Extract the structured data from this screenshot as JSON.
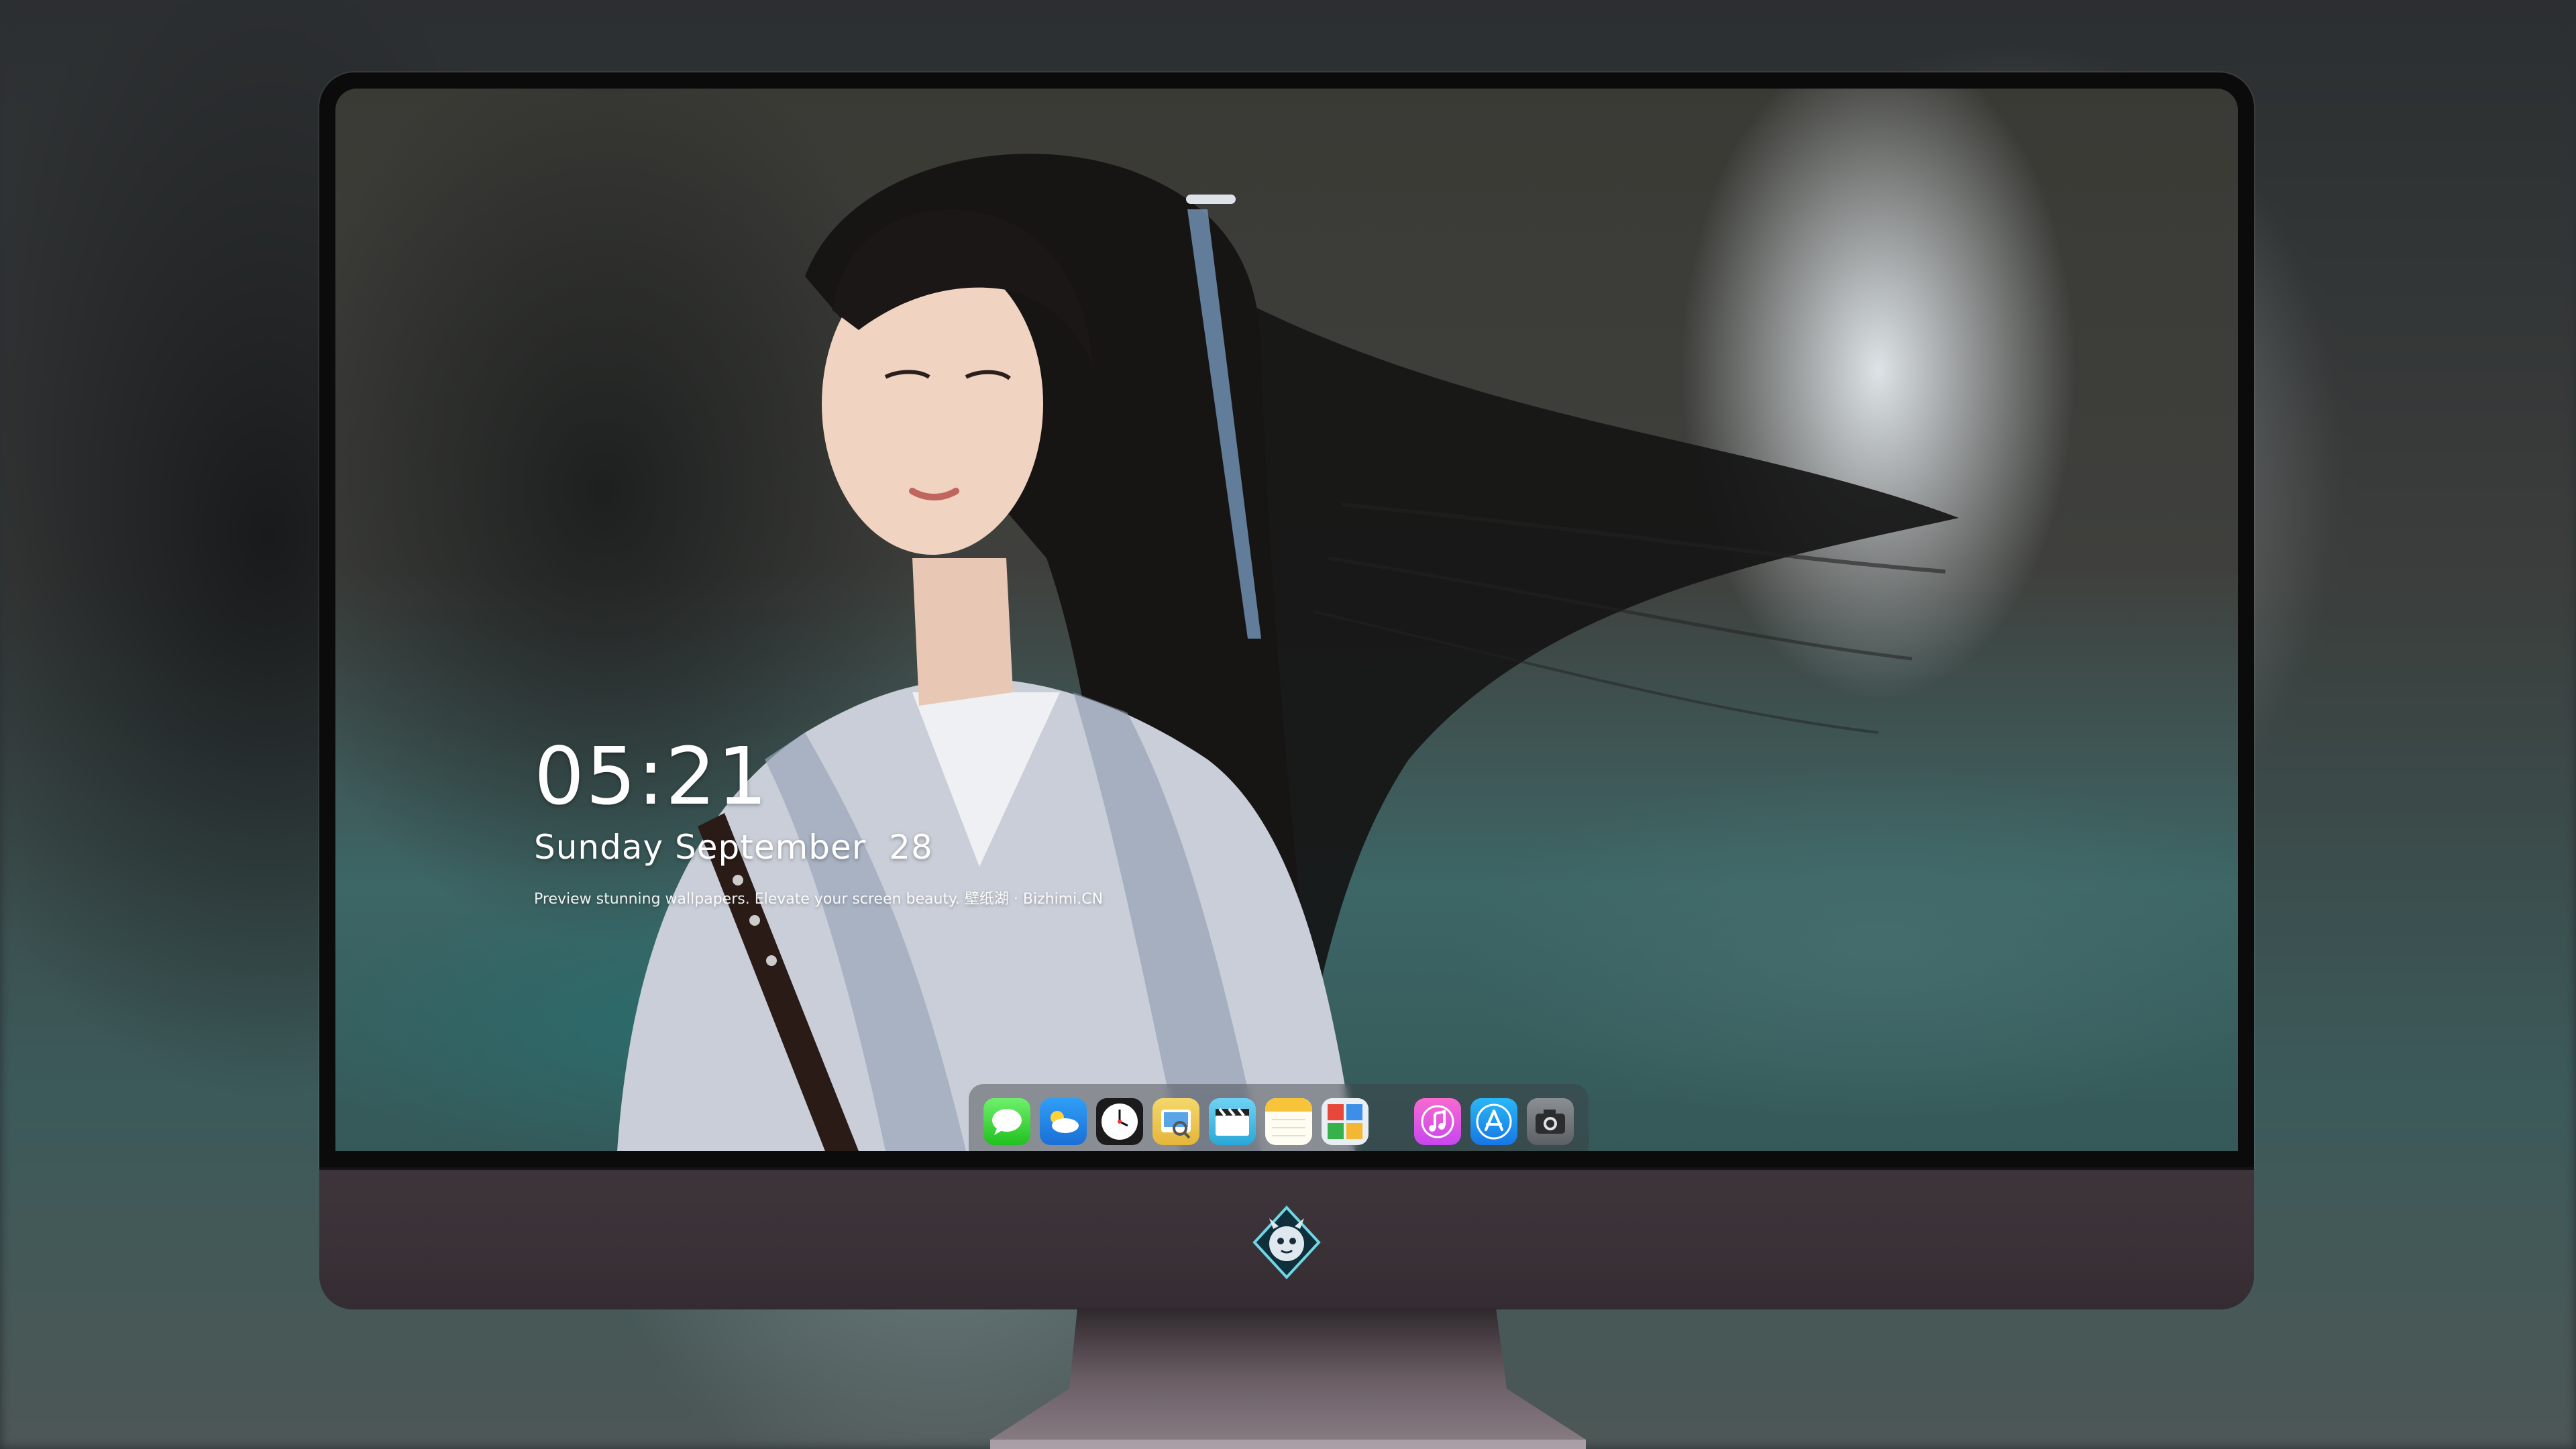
{
  "lock_screen": {
    "time": "05:21",
    "date": "Sunday September  28",
    "caption": "Preview stunning wallpapers. Elevate your screen beauty. 壁纸湖 · Bizhimi.CN"
  },
  "dock": {
    "apps": [
      {
        "name": "messages-icon"
      },
      {
        "name": "weather-icon"
      },
      {
        "name": "clock-icon"
      },
      {
        "name": "preview-icon"
      },
      {
        "name": "clips-icon"
      },
      {
        "name": "notes-icon"
      },
      {
        "name": "photo-booth-icon"
      },
      {
        "name": "music-icon"
      },
      {
        "name": "app-store-icon"
      },
      {
        "name": "camera-icon"
      }
    ]
  },
  "colors": {
    "bezel": "#0b0b0c",
    "chin": "#3d353a",
    "stand": "#5a4e55"
  }
}
